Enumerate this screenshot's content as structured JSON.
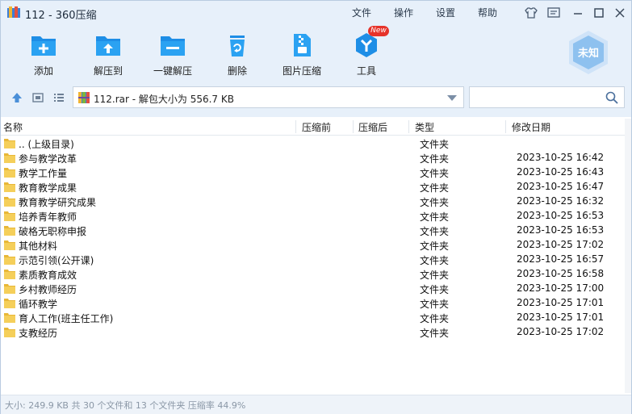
{
  "window": {
    "title": "112 - 360压缩"
  },
  "menu": {
    "file": "文件",
    "operate": "操作",
    "settings": "设置",
    "help": "帮助"
  },
  "toolbar": [
    {
      "label": "添加",
      "icon": "add-folder-icon"
    },
    {
      "label": "解压到",
      "icon": "extract-to-icon"
    },
    {
      "label": "一键解压",
      "icon": "one-click-extract-icon"
    },
    {
      "label": "删除",
      "icon": "trash-icon"
    },
    {
      "label": "图片压缩",
      "icon": "image-compress-icon"
    },
    {
      "label": "工具",
      "icon": "tools-icon"
    }
  ],
  "tools_badge": "New",
  "brand": {
    "label": "未知"
  },
  "address": {
    "text": "112.rar - 解包大小为 556.7 KB"
  },
  "search": {
    "placeholder": ""
  },
  "columns": {
    "name": "名称",
    "compressed": "压缩前",
    "after": "压缩后",
    "type": "类型",
    "modified": "修改日期"
  },
  "rows": [
    {
      "name": ".. (上级目录)",
      "type": "文件夹",
      "date": ""
    },
    {
      "name": "参与教学改革",
      "type": "文件夹",
      "date": "2023-10-25 16:42"
    },
    {
      "name": "教学工作量",
      "type": "文件夹",
      "date": "2023-10-25 16:43"
    },
    {
      "name": "教育教学成果",
      "type": "文件夹",
      "date": "2023-10-25 16:47"
    },
    {
      "name": "教育教学研究成果",
      "type": "文件夹",
      "date": "2023-10-25 16:32"
    },
    {
      "name": "培养青年教师",
      "type": "文件夹",
      "date": "2023-10-25 16:53"
    },
    {
      "name": "破格无职称申报",
      "type": "文件夹",
      "date": "2023-10-25 16:53"
    },
    {
      "name": "其他材料",
      "type": "文件夹",
      "date": "2023-10-25 17:02"
    },
    {
      "name": "示范引领(公开课)",
      "type": "文件夹",
      "date": "2023-10-25 16:57"
    },
    {
      "name": "素质教育成效",
      "type": "文件夹",
      "date": "2023-10-25 16:58"
    },
    {
      "name": "乡村教师经历",
      "type": "文件夹",
      "date": "2023-10-25 17:00"
    },
    {
      "name": "循环教学",
      "type": "文件夹",
      "date": "2023-10-25 17:01"
    },
    {
      "name": "育人工作(班主任工作)",
      "type": "文件夹",
      "date": "2023-10-25 17:01"
    },
    {
      "name": "支教经历",
      "type": "文件夹",
      "date": "2023-10-25 17:02"
    }
  ],
  "status": {
    "text": "大小: 249.9 KB 共 30 个文件和 13 个文件夹 压缩率 44.9%"
  }
}
